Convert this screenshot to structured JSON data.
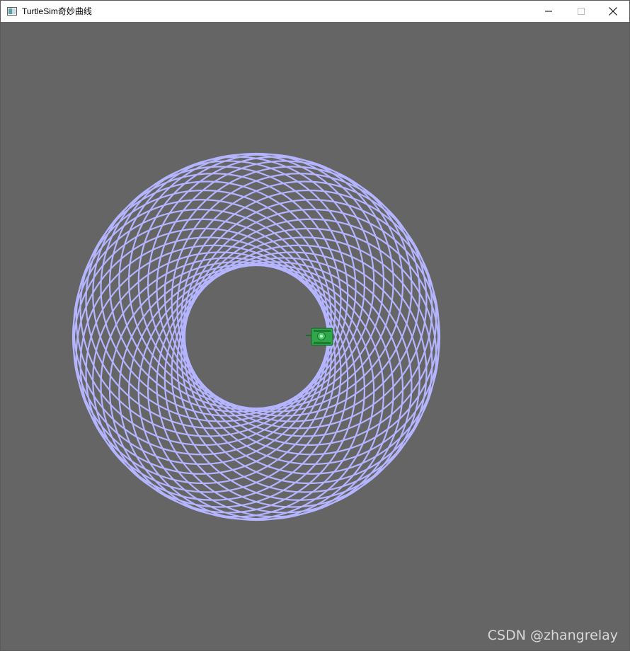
{
  "window": {
    "title": "TurtleSim奇妙曲线",
    "controls": [
      "minimize",
      "maximize",
      "close"
    ]
  },
  "canvas": {
    "background_color": "#656565",
    "pen_color": "#b4b4ff",
    "turtle_icon": "turtle-icon"
  },
  "watermark": "CSDN @zhangrelay"
}
